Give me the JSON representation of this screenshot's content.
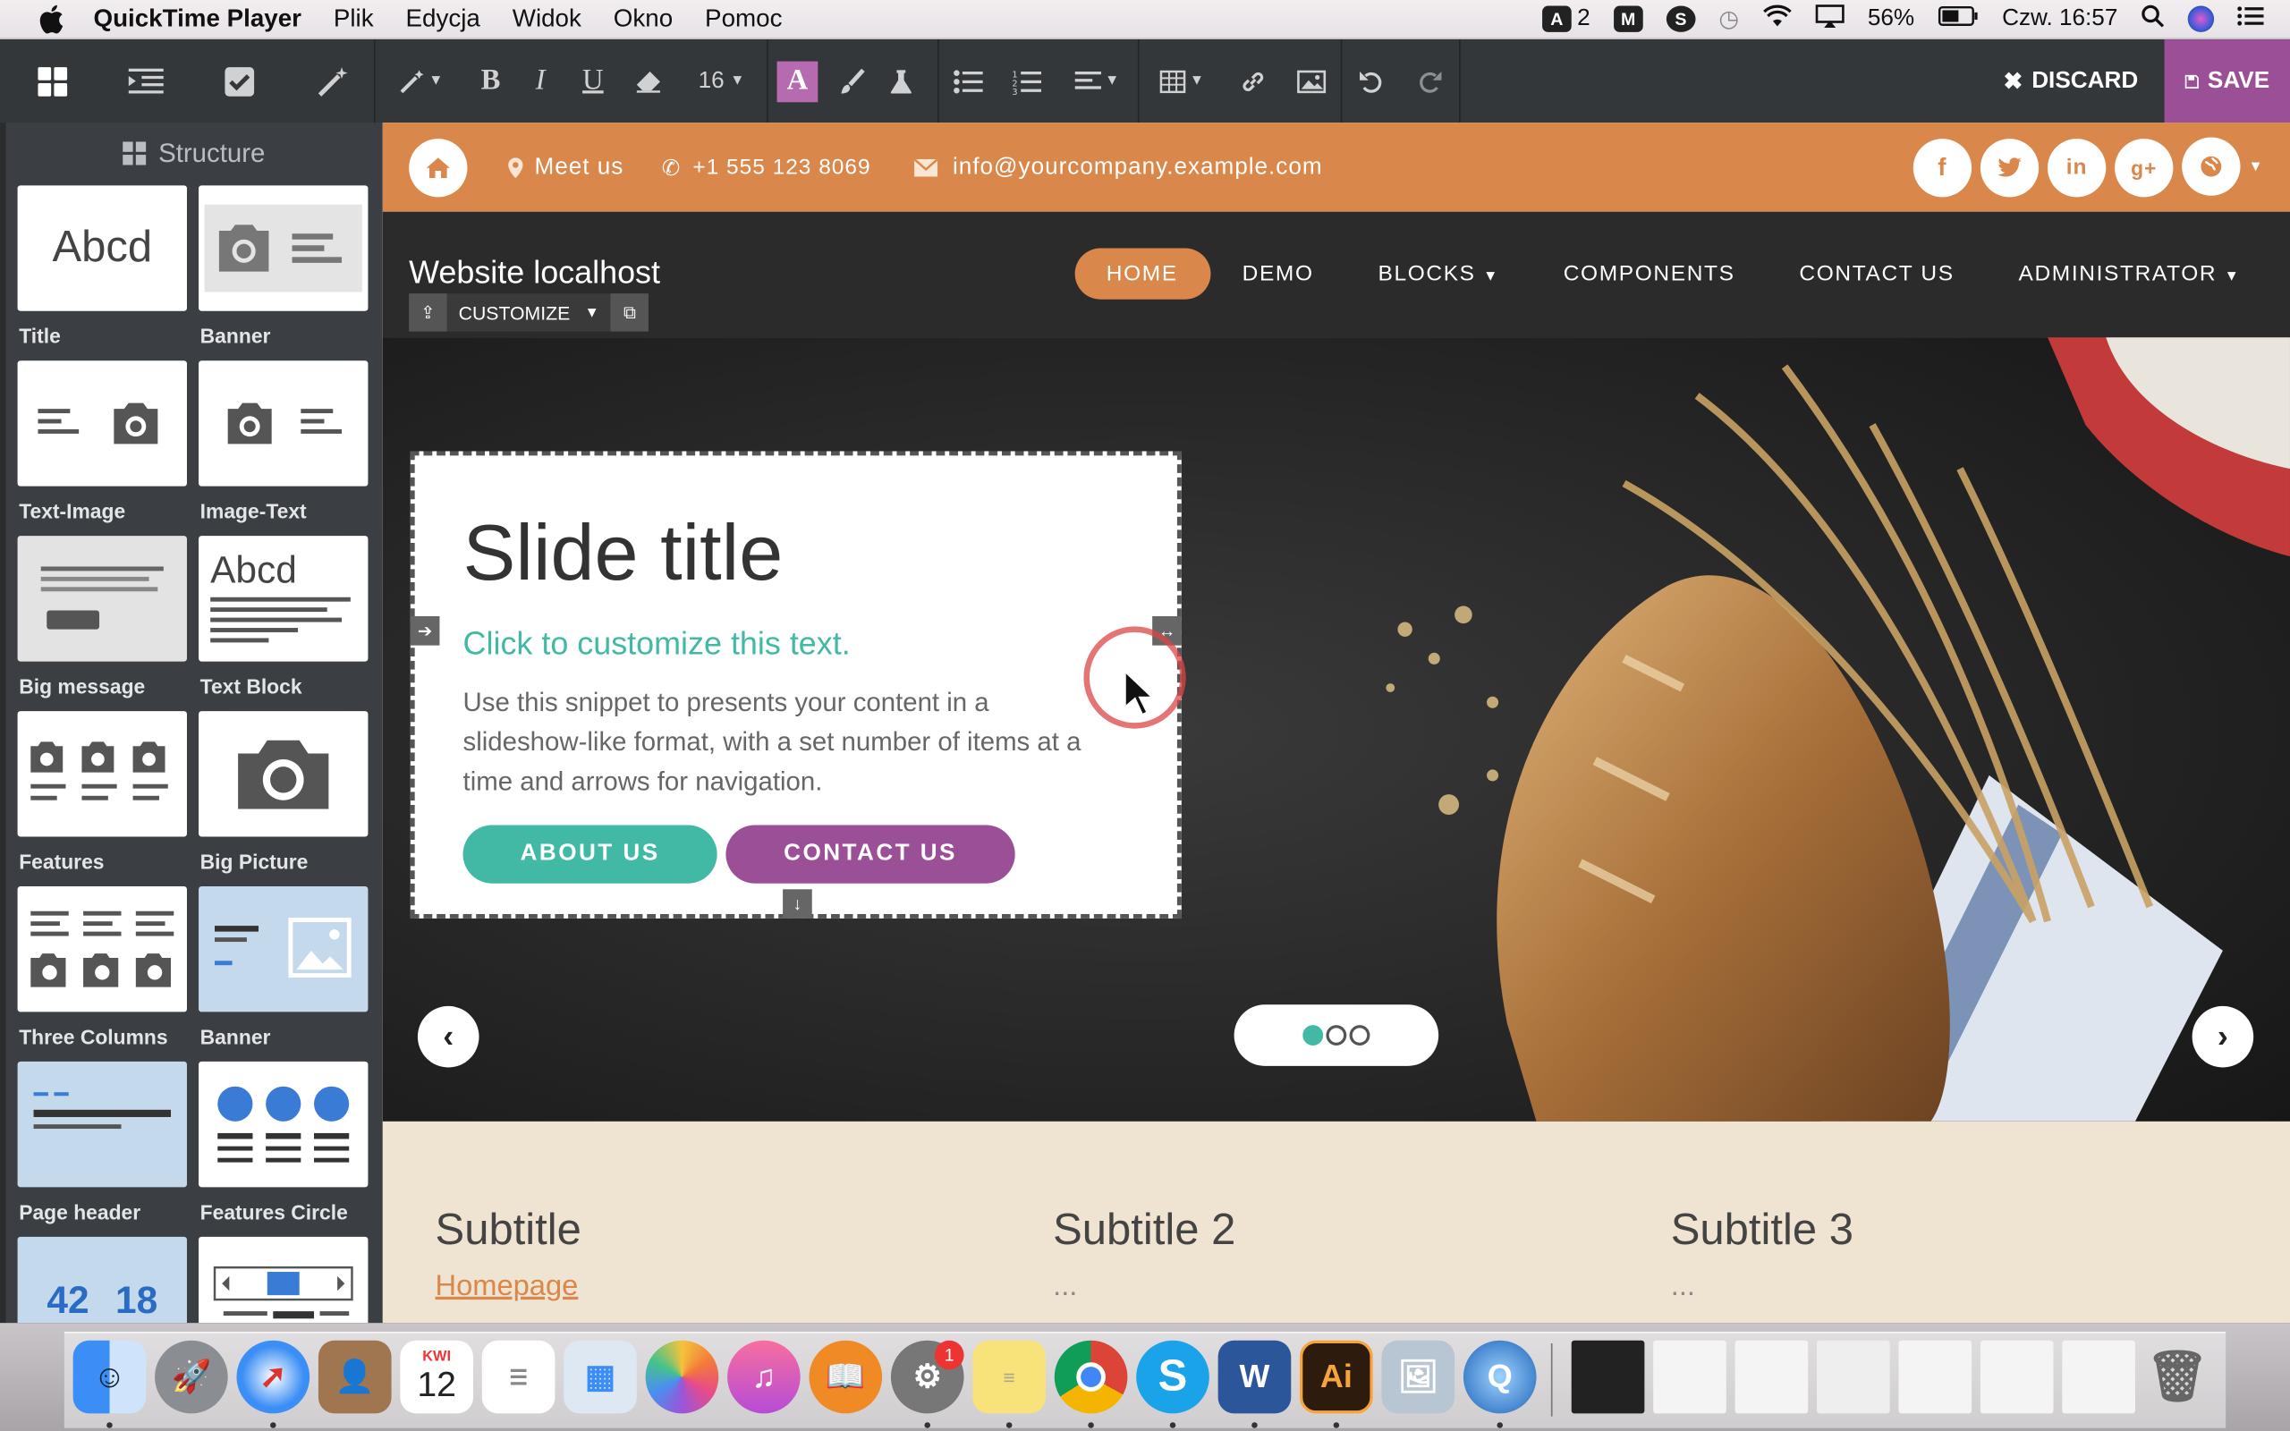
{
  "menubar": {
    "app": "QuickTime Player",
    "menus": [
      "Plik",
      "Edycja",
      "Widok",
      "Okno",
      "Pomoc"
    ],
    "status": {
      "adobe_count": "2",
      "battery": "56%",
      "clock": "Czw. 16:57"
    }
  },
  "toolbar": {
    "font_size": "16",
    "discard": "DISCARD",
    "save": "SAVE"
  },
  "sidebar": {
    "title": "Structure",
    "snippets": [
      {
        "label": "Title"
      },
      {
        "label": "Banner"
      },
      {
        "label": "Text-Image"
      },
      {
        "label": "Image-Text"
      },
      {
        "label": "Big message"
      },
      {
        "label": "Text Block"
      },
      {
        "label": "Features"
      },
      {
        "label": "Big Picture"
      },
      {
        "label": "Three Columns"
      },
      {
        "label": "Banner"
      },
      {
        "label": "Page header"
      },
      {
        "label": "Features Circle"
      }
    ],
    "thumb_text": {
      "abcd": "Abcd",
      "num1": "42",
      "num2": "18"
    }
  },
  "site": {
    "topbar": {
      "meet": "Meet us",
      "phone": "+1 555 123 8069",
      "email": "info@yourcompany.example.com"
    },
    "brand": "Website localhost",
    "customize": "CUSTOMIZE",
    "nav": [
      "HOME",
      "DEMO",
      "BLOCKS",
      "COMPONENTS",
      "CONTACT US",
      "ADMINISTRATOR"
    ],
    "slide": {
      "title": "Slide title",
      "subtitle": "Click to customize this text.",
      "body": "Use this snippet to presents your content in a slideshow-like format, with a set number of items at a time and arrows for navigation.",
      "btn_about": "ABOUT US",
      "btn_contact": "CONTACT US"
    },
    "columns": [
      {
        "title": "Subtitle",
        "text": "Homepage"
      },
      {
        "title": "Subtitle 2",
        "text": "..."
      },
      {
        "title": "Subtitle 3",
        "text": "..."
      }
    ]
  },
  "dock": {
    "calendar_month": "KWI",
    "calendar_day": "12",
    "badge": "1",
    "illustrator": "Ai",
    "word": "W"
  },
  "colors": {
    "accent": "#d9874a",
    "teal": "#42b9a4",
    "purple": "#9b4f96"
  }
}
